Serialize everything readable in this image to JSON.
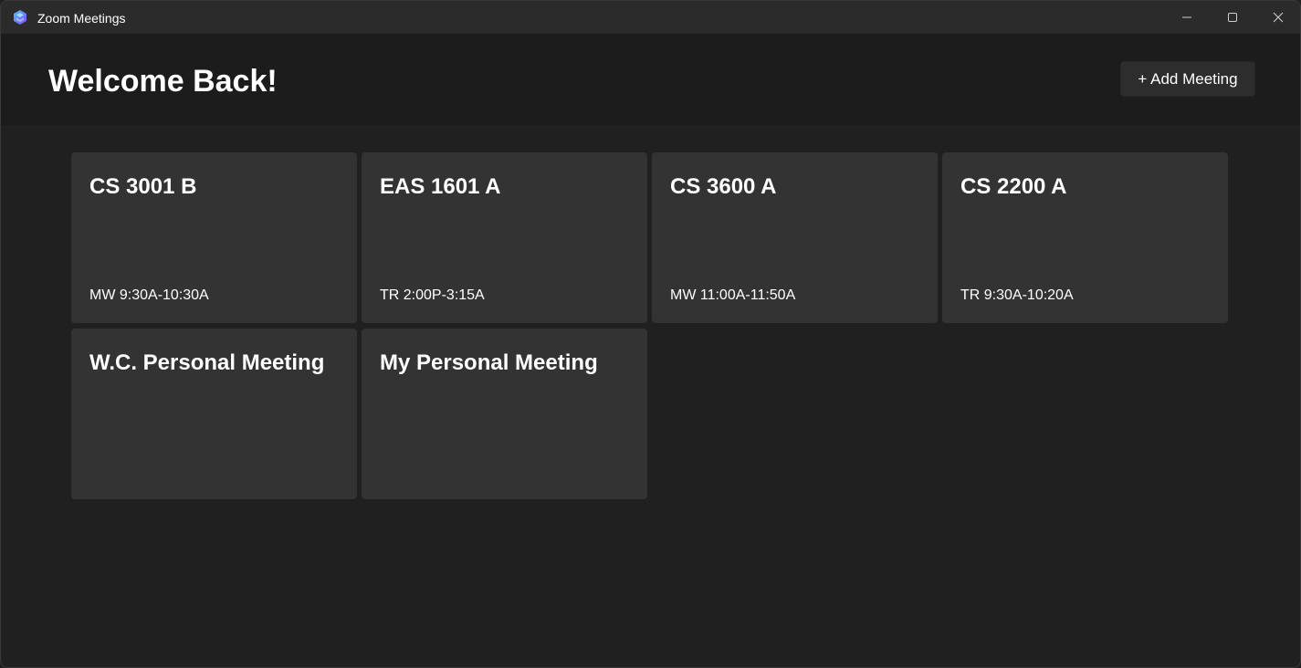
{
  "window": {
    "title": "Zoom Meetings",
    "app_icon": "zoom-meetings-app-icon",
    "controls": {
      "minimize_icon": "minimize-icon",
      "maximize_icon": "maximize-icon",
      "close_icon": "close-icon"
    }
  },
  "header": {
    "title": "Welcome Back!",
    "add_button_label": "+ Add Meeting"
  },
  "meetings": [
    {
      "title": "CS 3001 B",
      "time": "MW 9:30A-10:30A"
    },
    {
      "title": "EAS 1601 A",
      "time": "TR 2:00P-3:15A"
    },
    {
      "title": "CS 3600 A",
      "time": "MW 11:00A-11:50A"
    },
    {
      "title": "CS 2200 A",
      "time": "TR 9:30A-10:20A"
    },
    {
      "title": "W.C. Personal Meeting",
      "time": ""
    },
    {
      "title": "My Personal Meeting",
      "time": ""
    }
  ],
  "colors": {
    "titlebar": "#2b2b2b",
    "header": "#1c1c1c",
    "background": "#202020",
    "card": "#333333",
    "button": "#2d2d2d",
    "text": "#ffffff"
  }
}
